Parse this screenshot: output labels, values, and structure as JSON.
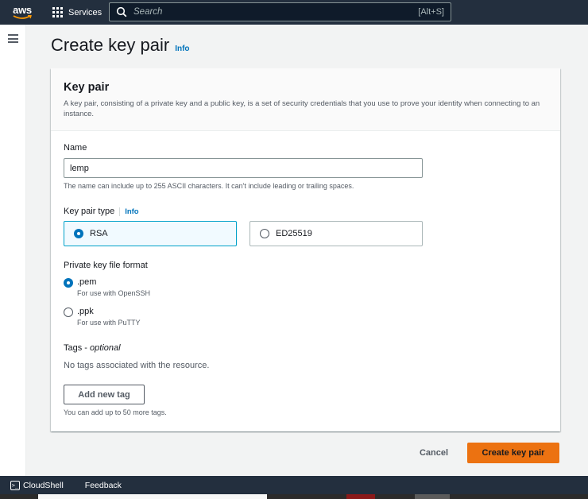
{
  "topnav": {
    "logo_text": "aws",
    "services_label": "Services",
    "search_placeholder": "Search",
    "search_shortcut": "[Alt+S]"
  },
  "page": {
    "title": "Create key pair",
    "info_label": "Info"
  },
  "panel": {
    "header_title": "Key pair",
    "header_description": "A key pair, consisting of a private key and a public key, is a set of security credentials that you use to prove your identity when connecting to an instance.",
    "name_label": "Name",
    "name_value": "lemp",
    "name_hint": "The name can include up to 255 ASCII characters. It can't include leading or trailing spaces.",
    "type_label": "Key pair type",
    "type_info": "Info",
    "type_options": [
      {
        "label": "RSA",
        "selected": true
      },
      {
        "label": "ED25519",
        "selected": false
      }
    ],
    "format_label": "Private key file format",
    "format_options": [
      {
        "label": ".pem",
        "sub": "For use with OpenSSH",
        "selected": true
      },
      {
        "label": ".ppk",
        "sub": "For use with PuTTY",
        "selected": false
      }
    ],
    "tags_label": "Tags",
    "tags_optional": "optional",
    "tags_empty": "No tags associated with the resource.",
    "add_tag_label": "Add new tag",
    "tags_hint": "You can add up to 50 more tags."
  },
  "actions": {
    "cancel_label": "Cancel",
    "create_label": "Create key pair"
  },
  "footer": {
    "cloudshell_label": "CloudShell",
    "feedback_label": "Feedback"
  },
  "colors": {
    "nav_bg": "#232f3e",
    "primary": "#ec7211",
    "link": "#0073bb",
    "selected_tile": "#f1faff"
  }
}
